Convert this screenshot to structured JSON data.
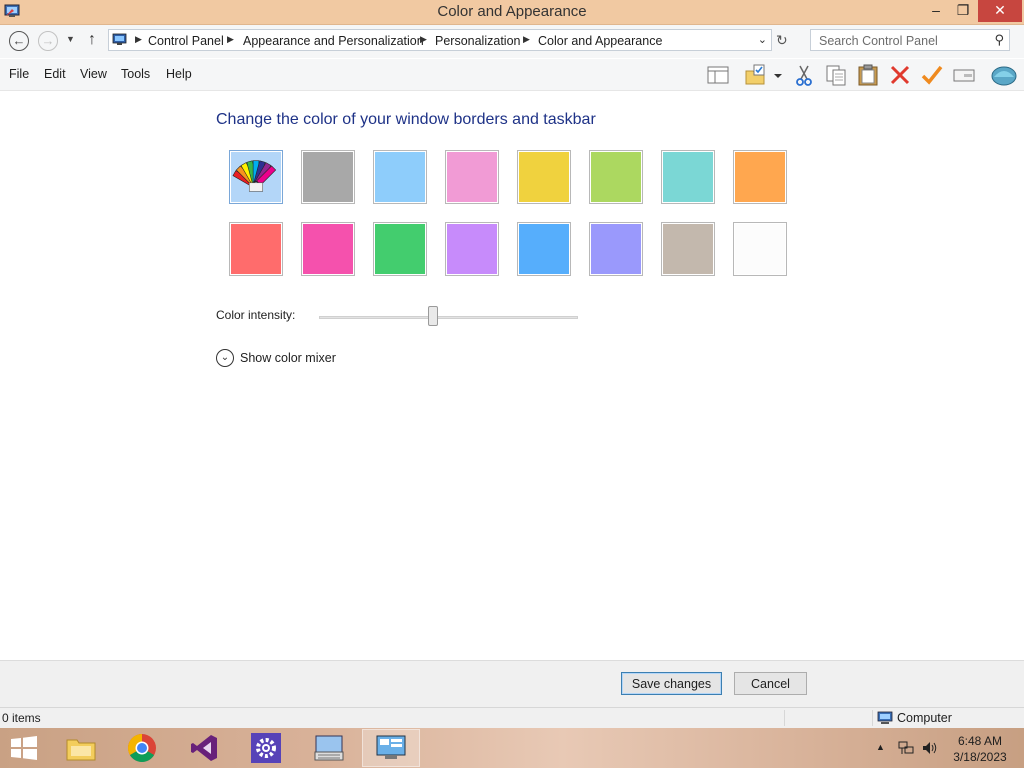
{
  "window": {
    "title": "Color and Appearance",
    "controls": {
      "minimize": "–",
      "maximize": "❐",
      "close": "✕"
    }
  },
  "address": {
    "crumbs": [
      "Control Panel",
      "Appearance and Personalization",
      "Personalization",
      "Color and Appearance"
    ],
    "search_placeholder": "Search Control Panel"
  },
  "menu": {
    "items": [
      "File",
      "Edit",
      "View",
      "Tools",
      "Help"
    ]
  },
  "toolbar": {
    "icons": [
      "layout-pane-icon",
      "folder-checkmark-icon",
      "dropdown-arrow-icon",
      "cut-icon",
      "copy-icon",
      "paste-icon",
      "delete-icon",
      "checkmark-icon",
      "properties-icon",
      "shell-icon"
    ]
  },
  "content": {
    "heading": "Change the color of your window borders and taskbar",
    "swatches": [
      {
        "name": "automatic",
        "color": "#b3d6f8",
        "selected": true
      },
      {
        "name": "gray",
        "color": "#a8a8a8"
      },
      {
        "name": "sky-blue",
        "color": "#8ecdfb"
      },
      {
        "name": "pink",
        "color": "#f19bd5"
      },
      {
        "name": "yellow",
        "color": "#f0d23e"
      },
      {
        "name": "lime",
        "color": "#acd860"
      },
      {
        "name": "teal",
        "color": "#7bd7d5"
      },
      {
        "name": "orange",
        "color": "#ffa74f"
      },
      {
        "name": "red",
        "color": "#ff6c6c"
      },
      {
        "name": "magenta",
        "color": "#f551ad"
      },
      {
        "name": "green",
        "color": "#43cd6e"
      },
      {
        "name": "purple",
        "color": "#c78bfb"
      },
      {
        "name": "blue",
        "color": "#56aefc"
      },
      {
        "name": "periwinkle",
        "color": "#9a99fc"
      },
      {
        "name": "taupe",
        "color": "#c3b8ad"
      },
      {
        "name": "white",
        "color": "#fcfcfc"
      }
    ],
    "intensity_label": "Color intensity:",
    "intensity_value": 0.44,
    "mixer_label": "Show color mixer"
  },
  "buttons": {
    "save": "Save changes",
    "cancel": "Cancel"
  },
  "status": {
    "items": "0 items",
    "location": "Computer"
  },
  "taskbar": {
    "apps": [
      "file-explorer-icon",
      "chrome-icon",
      "visual-studio-icon",
      "settings-icon",
      "keyboard-icon",
      "control-panel-icon"
    ],
    "time": "6:48 AM",
    "date": "3/18/2023"
  }
}
